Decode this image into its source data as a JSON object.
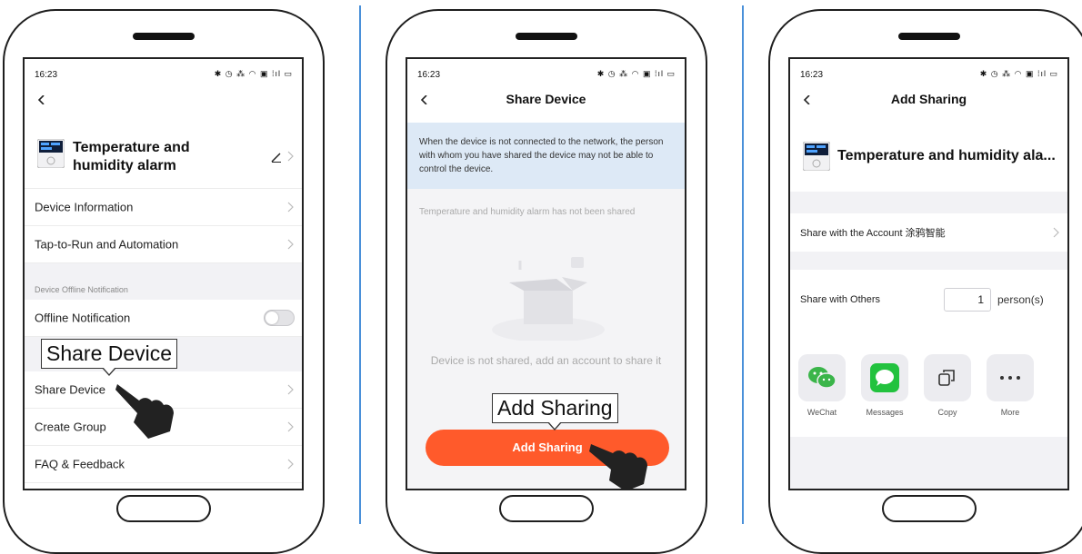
{
  "status": {
    "time": "16:23",
    "icons": "✱ ◷ ⁂ ◠ ▣ ⁞ıl ▭"
  },
  "panel1": {
    "device_name": "Temperature and humidity alarm",
    "items": {
      "device_info": "Device Information",
      "tap_to_run": "Tap-to-Run and Automation",
      "offline_section": "Device Offline Notification",
      "offline_notification": "Offline Notification",
      "share_device": "Share Device",
      "create_group": "Create Group",
      "faq": "FAQ & Feedback"
    },
    "callout": "Share Device",
    "offline_toggle_on": false
  },
  "panel2": {
    "title": "Share Device",
    "notice": "When the device is not connected to the network, the person with whom you have shared the device may not be able to control the device.",
    "not_shared_text": "Temperature and humidity alarm has not been shared",
    "empty_text": "Device is not shared, add an account to share it",
    "callout": "Add Sharing",
    "button": "Add Sharing"
  },
  "panel3": {
    "title": "Add Sharing",
    "device_name": "Temperature and humidity ala...",
    "share_account": "Share with the Account 涂鸦智能",
    "share_others": "Share with Others",
    "count": "1",
    "unit": "person(s)",
    "share_options": {
      "wechat": "WeChat",
      "messages": "Messages",
      "copy": "Copy",
      "more": "More"
    }
  },
  "colors": {
    "accent": "#ff5a2b",
    "divider": "#4a90d9",
    "notice_bg": "#dde9f6",
    "wechat": "#3bb54a",
    "messages": "#22c23e"
  }
}
